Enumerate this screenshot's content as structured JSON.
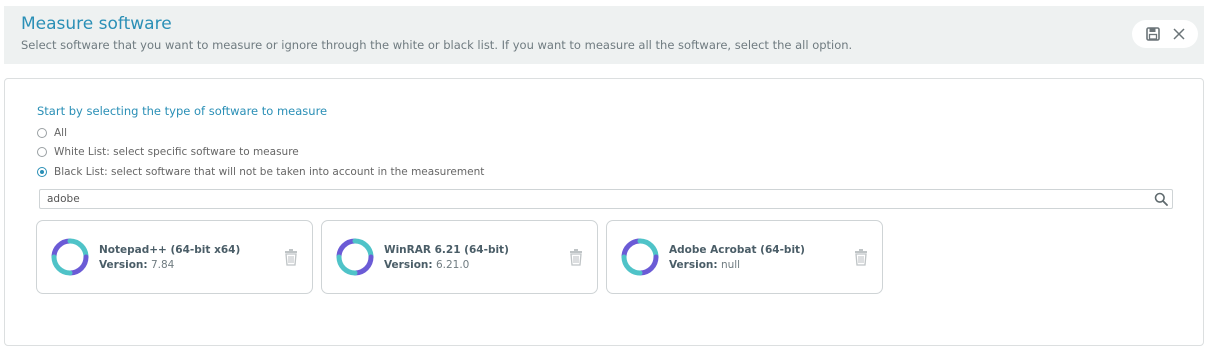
{
  "header": {
    "title": "Measure software",
    "subtitle": "Select software that you want to measure or ignore through the white or black list. If you want to measure all the software, select the all option.",
    "actions": {
      "save_icon": "save-icon",
      "close_icon": "close-icon"
    }
  },
  "form": {
    "section_label": "Start by selecting the type of software to measure",
    "options": [
      {
        "label": "All",
        "checked": false
      },
      {
        "label": "White List: select specific software to measure",
        "checked": false
      },
      {
        "label": "Black List: select software that will not be taken into account in the measurement",
        "checked": true
      }
    ],
    "search": {
      "value": "adobe",
      "icon": "search-icon"
    }
  },
  "software": [
    {
      "name": "Notepad++ (64-bit x64)",
      "version_label": "Version:",
      "version": "7.84"
    },
    {
      "name": "WinRAR 6.21 (64-bit)",
      "version_label": "Version:",
      "version": "6.21.0"
    },
    {
      "name": "Adobe Acrobat (64-bit)",
      "version_label": "Version:",
      "version": "null"
    }
  ],
  "colors": {
    "accent": "#2a8fb6",
    "logo_teal": "#4fc3c8",
    "logo_purple": "#6b5bd6"
  }
}
